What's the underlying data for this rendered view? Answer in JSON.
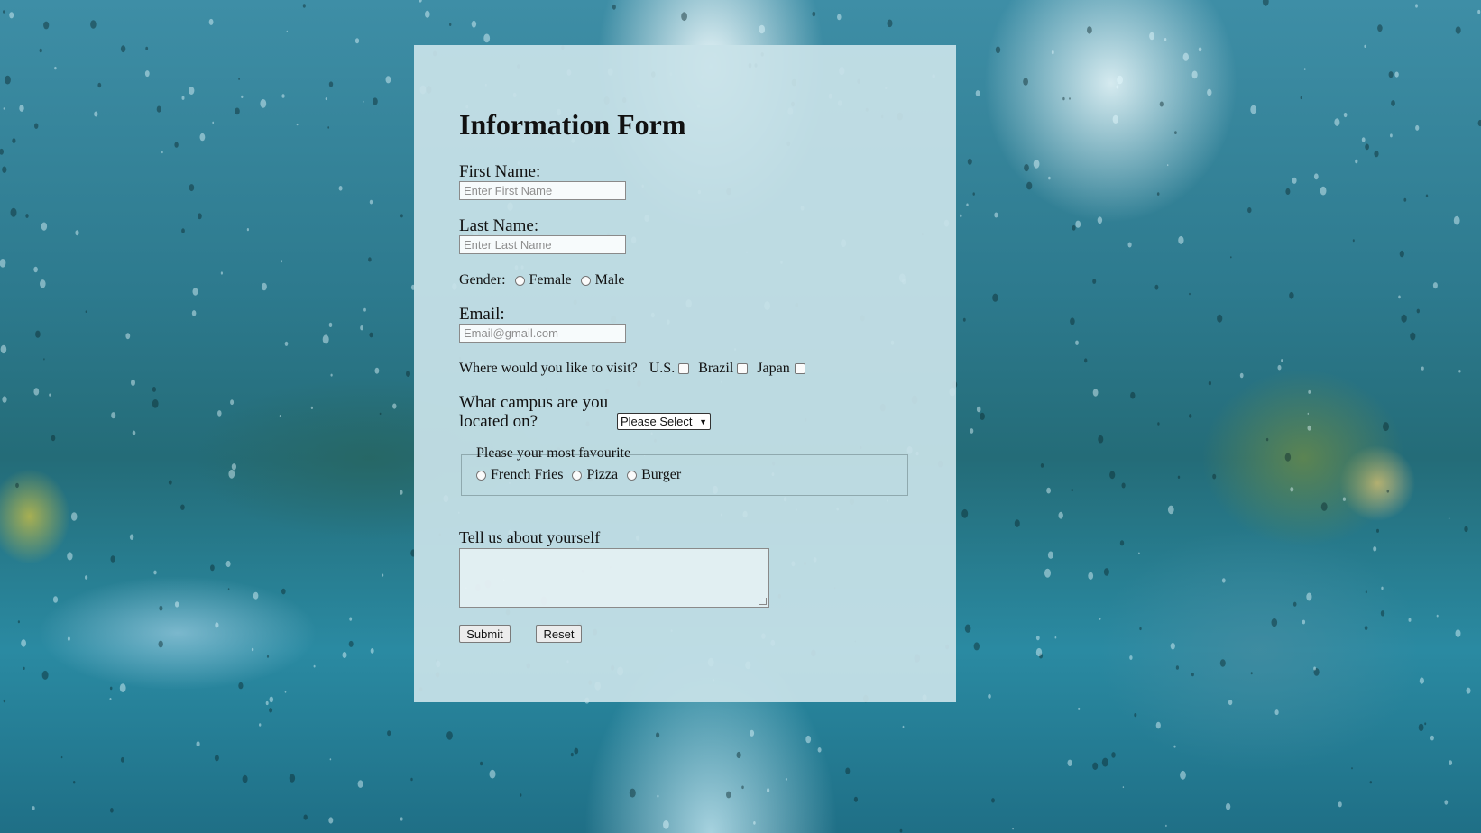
{
  "form": {
    "title": "Information Form",
    "first_name": {
      "label": "First Name:",
      "placeholder": "Enter First Name"
    },
    "last_name": {
      "label": "Last Name:",
      "placeholder": "Enter Last Name"
    },
    "gender": {
      "label": "Gender:",
      "options": [
        "Female",
        "Male"
      ]
    },
    "email": {
      "label": "Email:",
      "placeholder": "Email@gmail.com"
    },
    "visit": {
      "label": "Where would you like to visit?",
      "options": [
        "U.S.",
        "Brazil",
        "Japan"
      ]
    },
    "campus": {
      "label_line1": "What campus are you",
      "label_line2": "located on?",
      "selected": "Please Select"
    },
    "favourite": {
      "legend": "Please your most favourite",
      "options": [
        "French Fries",
        "Pizza",
        "Burger"
      ]
    },
    "about": {
      "label": "Tell us about yourself"
    },
    "buttons": {
      "submit": "Submit",
      "reset": "Reset"
    }
  }
}
